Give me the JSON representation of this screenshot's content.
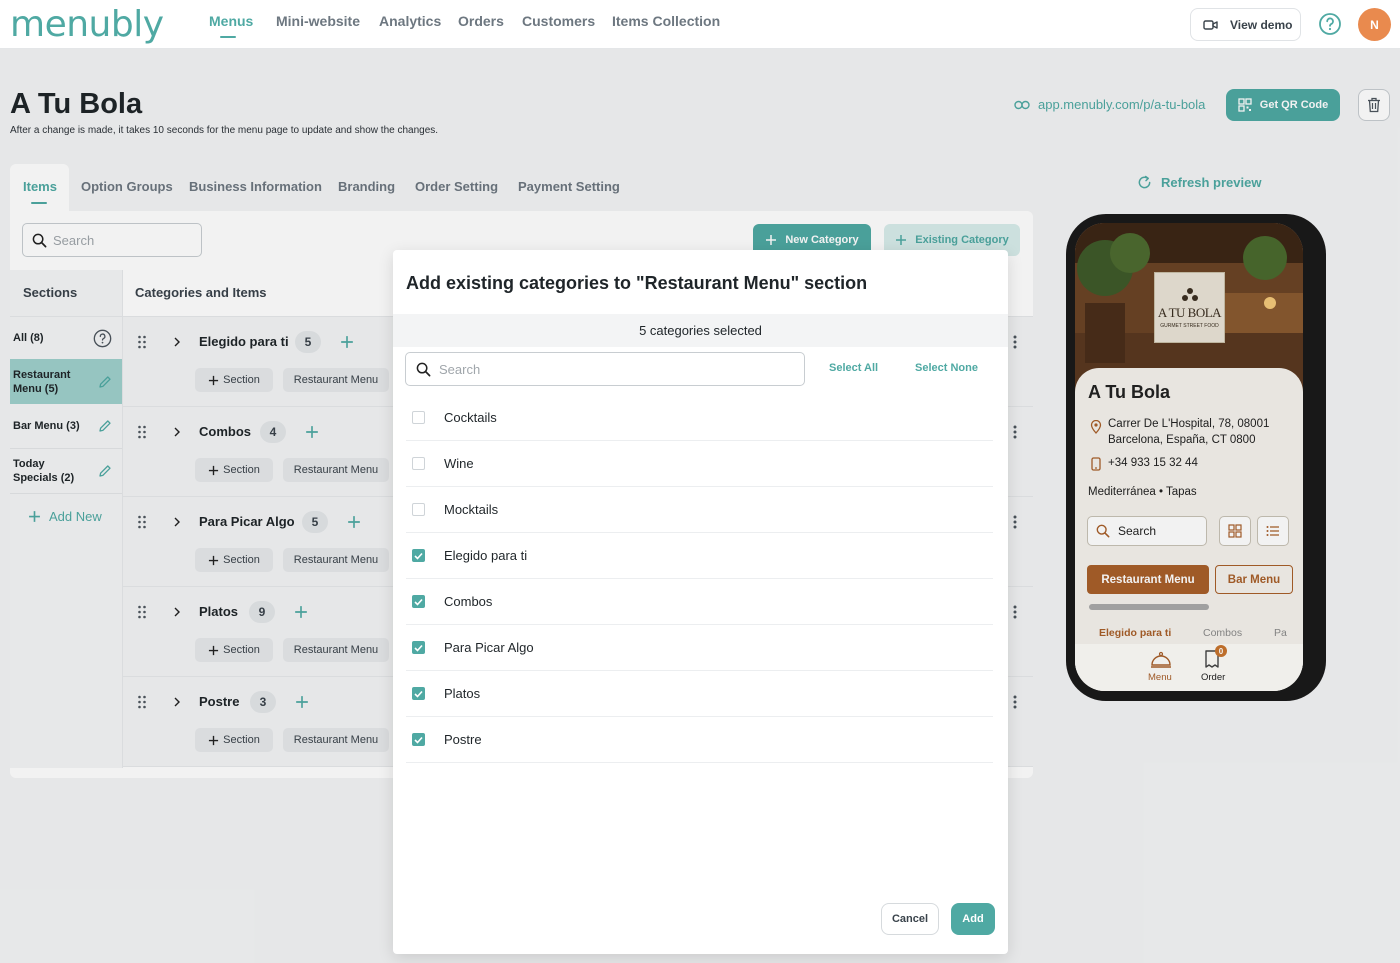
{
  "brand": {
    "logo_text": "menubly",
    "accent": "#4fa9a3"
  },
  "nav": {
    "items": [
      "Menus",
      "Mini-website",
      "Analytics",
      "Orders",
      "Customers",
      "Items Collection"
    ],
    "active": "Menus",
    "view_demo": "View demo",
    "avatar_initial": "N"
  },
  "page": {
    "title": "A Tu Bola",
    "subtitle": "After a change is made, it takes 10 seconds for the menu page to update and show the changes.",
    "link": "app.menubly.com/p/a-tu-bola",
    "qr_button": "Get QR Code"
  },
  "tabs": [
    "Items",
    "Option Groups",
    "Business Information",
    "Branding",
    "Order Setting",
    "Payment Setting"
  ],
  "refresh_label": "Refresh preview",
  "toolbar": {
    "search_placeholder": "Search",
    "new_category": "New Category",
    "existing_category": "Existing Category"
  },
  "sections": {
    "header": "Sections",
    "items": [
      {
        "label": "All (8)"
      },
      {
        "label": "Restaurant Menu (5)"
      },
      {
        "label": "Bar Menu (3)"
      },
      {
        "label": "Today Specials (2)"
      }
    ],
    "add_new": "Add New"
  },
  "categories": {
    "header": "Categories and Items",
    "section_chip": "Section",
    "menu_chip": "Restaurant Menu",
    "rows": [
      {
        "name": "Elegido para ti",
        "count": "5"
      },
      {
        "name": "Combos",
        "count": "4"
      },
      {
        "name": "Para Picar Algo",
        "count": "5"
      },
      {
        "name": "Platos",
        "count": "9"
      },
      {
        "name": "Postre",
        "count": "3"
      }
    ]
  },
  "modal": {
    "title": "Add existing categories to \"Restaurant Menu\" section",
    "selected_text": "5 categories selected",
    "search_placeholder": "Search",
    "select_all": "Select All",
    "select_none": "Select None",
    "options": [
      {
        "label": "Cocktails",
        "checked": false
      },
      {
        "label": "Wine",
        "checked": false
      },
      {
        "label": "Mocktails",
        "checked": false
      },
      {
        "label": "Elegido para ti",
        "checked": true
      },
      {
        "label": "Combos",
        "checked": true
      },
      {
        "label": "Para Picar Algo",
        "checked": true
      },
      {
        "label": "Platos",
        "checked": true
      },
      {
        "label": "Postre",
        "checked": true
      }
    ],
    "cancel": "Cancel",
    "add": "Add"
  },
  "preview": {
    "logo_line1": "A TU BOLA",
    "logo_line2": "GURMET STREET FOOD",
    "name": "A Tu Bola",
    "address": "Carrer De L'Hospital, 78, 08001 Barcelona, España, CT 0800",
    "phone": "+34 933 15 32 44",
    "tags": "Mediterránea • Tapas",
    "search": "Search",
    "menu_tabs": [
      "Restaurant Menu",
      "Bar Menu"
    ],
    "category_tabs": [
      "Elegido para ti",
      "Combos",
      "Pa"
    ],
    "bottom_nav": [
      "Menu",
      "Order"
    ],
    "order_badge": "0",
    "accent": "#a85f2a"
  }
}
